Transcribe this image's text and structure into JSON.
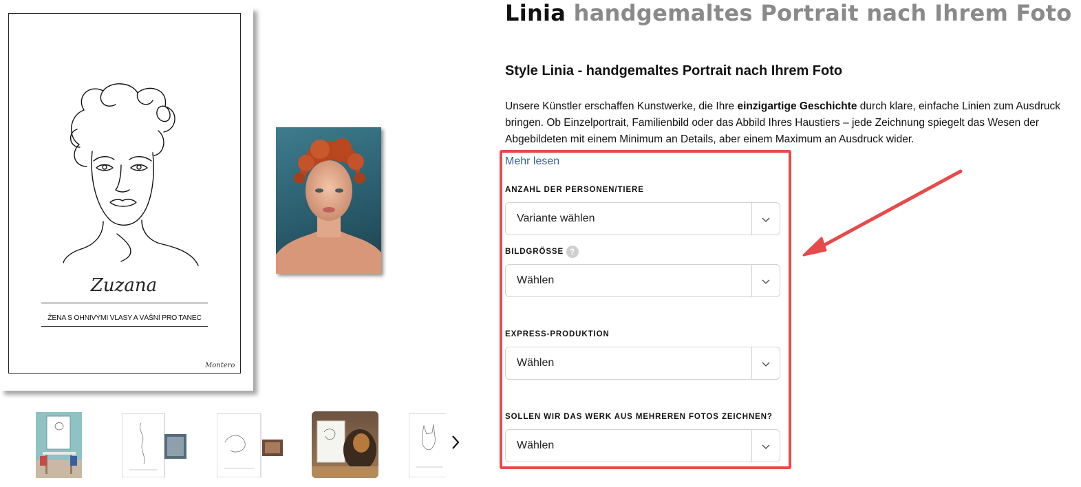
{
  "gallery": {
    "main_image": {
      "name_signature": "Zuzana",
      "caption": "ŽENA S OHNIVÝMI VLASY A VÁŠNÍ PRO TANEC",
      "artist_signature": "Montero"
    },
    "thumbnails_count_visible": 5,
    "next_icon": "chevron-right-icon"
  },
  "product": {
    "title_brand": "Linia",
    "title_rest": "handgemaltes Portrait nach Ihrem Foto",
    "subtitle": "Style Linia - handgemaltes Portrait nach Ihrem Foto",
    "description_before": "Unsere Künstler erschaffen Kunstwerke, die Ihre ",
    "description_bold": "einzigartige Geschichte",
    "description_after": " durch klare, einfache Linien zum Ausdruck bringen. Ob Einzelportrait, Familienbild oder das Abbild Ihres Haustiers – jede Zeichnung spiegelt das Wesen der Abgebildeten mit einem Minimum an Details, aber einem Maximum an Ausdruck wider.",
    "read_more": "Mehr lesen"
  },
  "options": [
    {
      "label": "ANZAHL DER PERSONEN/TIERE",
      "value": "Variante wählen",
      "has_help": false
    },
    {
      "label": "BILDGRÖSSE",
      "value": "Wählen",
      "has_help": true,
      "help_icon_text": "?"
    },
    {
      "label": "EXPRESS-PRODUKTION",
      "value": "Wählen",
      "has_help": false
    },
    {
      "label": "SOLLEN WIR DAS WERK AUS MEHREREN FOTOS ZEICHNEN?",
      "value": "Wählen",
      "has_help": false
    }
  ],
  "annotation": {
    "highlight_color": "#e64a4a"
  },
  "colors": {
    "link": "#3a5fa0",
    "title_gray": "#8a8a8a",
    "border": "#d2d2d2"
  }
}
